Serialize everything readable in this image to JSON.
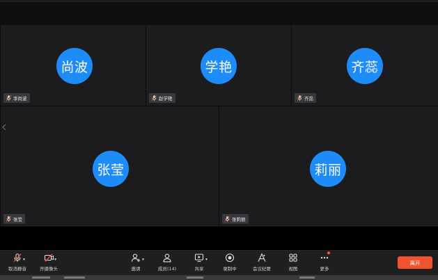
{
  "participants": [
    {
      "avatar_text": "尚波",
      "name": "李尚波"
    },
    {
      "avatar_text": "学艳",
      "name": "赵学艳"
    },
    {
      "avatar_text": "齐蕊",
      "name": "齐蕊"
    },
    {
      "avatar_text": "张莹",
      "name": "张莹"
    },
    {
      "avatar_text": "莉丽",
      "name": "张莉丽"
    }
  ],
  "toolbar": {
    "mute_label": "取消静音",
    "camera_label": "开摄像头",
    "invite_label": "邀请",
    "members_label": "成员(14)",
    "share_label": "共享",
    "record_label": "录制中",
    "minutes_label": "会议纪要",
    "view_label": "视图",
    "more_label": "更多",
    "leave_label": "离开"
  },
  "colors": {
    "avatar": "#1d8cf8",
    "tile": "#1c1c1e",
    "toolbar": "#1f1f21",
    "leave": "#f2532c",
    "muted_mic": "#ff5a2c"
  }
}
